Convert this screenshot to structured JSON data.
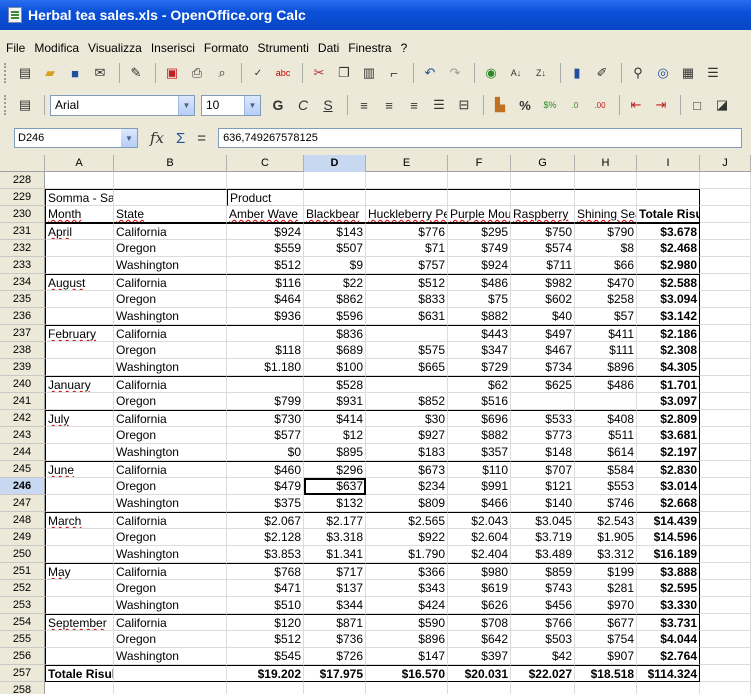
{
  "window": {
    "title": "Herbal tea sales.xls - OpenOffice.org Calc"
  },
  "menu": [
    "File",
    "Modifica",
    "Visualizza",
    "Inserisci",
    "Formato",
    "Strumenti",
    "Dati",
    "Finestra",
    "?"
  ],
  "toolbar": {
    "font_name": "Arial",
    "font_size": "10"
  },
  "formula": {
    "cell_ref": "D246",
    "content": "636,749267578125"
  },
  "columns": [
    "A",
    "B",
    "C",
    "D",
    "E",
    "F",
    "G",
    "H",
    "I",
    "J"
  ],
  "selected_column": "D",
  "selected_row": "246",
  "table": {
    "row_228": "228",
    "header_row_229": {
      "rownum": "229",
      "a": "Somma - Sales $",
      "c": "Product"
    },
    "header_row_230": {
      "rownum": "230",
      "a": "Month",
      "b": "State",
      "c": "Amber Wave",
      "d": "Blackbear",
      "e": "Huckleberry Peach",
      "f": "Purple Mountain",
      "g": "Raspberry",
      "h": "Shining Sea",
      "i": "Totale Risultato"
    },
    "data_rows": [
      {
        "rownum": "231",
        "month": "April",
        "state": "California",
        "c": "$924",
        "d": "$143",
        "e": "$776",
        "f": "$295",
        "g": "$750",
        "h": "$790",
        "i": "$3.678"
      },
      {
        "rownum": "232",
        "month": "",
        "state": "Oregon",
        "c": "$559",
        "d": "$507",
        "e": "$71",
        "f": "$749",
        "g": "$574",
        "h": "$8",
        "i": "$2.468"
      },
      {
        "rownum": "233",
        "month": "",
        "state": "Washington",
        "c": "$512",
        "d": "$9",
        "e": "$757",
        "f": "$924",
        "g": "$711",
        "h": "$66",
        "i": "$2.980"
      },
      {
        "rownum": "234",
        "month": "August",
        "state": "California",
        "c": "$116",
        "d": "$22",
        "e": "$512",
        "f": "$486",
        "g": "$982",
        "h": "$470",
        "i": "$2.588"
      },
      {
        "rownum": "235",
        "month": "",
        "state": "Oregon",
        "c": "$464",
        "d": "$862",
        "e": "$833",
        "f": "$75",
        "g": "$602",
        "h": "$258",
        "i": "$3.094"
      },
      {
        "rownum": "236",
        "month": "",
        "state": "Washington",
        "c": "$936",
        "d": "$596",
        "e": "$631",
        "f": "$882",
        "g": "$40",
        "h": "$57",
        "i": "$3.142"
      },
      {
        "rownum": "237",
        "month": "February",
        "state": "California",
        "c": "",
        "d": "$836",
        "e": "",
        "f": "$443",
        "g": "$497",
        "h": "$411",
        "i": "$2.186"
      },
      {
        "rownum": "238",
        "month": "",
        "state": "Oregon",
        "c": "$118",
        "d": "$689",
        "e": "$575",
        "f": "$347",
        "g": "$467",
        "h": "$111",
        "i": "$2.308"
      },
      {
        "rownum": "239",
        "month": "",
        "state": "Washington",
        "c": "$1.180",
        "d": "$100",
        "e": "$665",
        "f": "$729",
        "g": "$734",
        "h": "$896",
        "i": "$4.305"
      },
      {
        "rownum": "240",
        "month": "January",
        "state": "California",
        "c": "",
        "d": "$528",
        "e": "",
        "f": "$62",
        "g": "$625",
        "h": "$486",
        "i": "$1.701"
      },
      {
        "rownum": "241",
        "month": "",
        "state": "Oregon",
        "c": "$799",
        "d": "$931",
        "e": "$852",
        "f": "$516",
        "g": "",
        "h": "",
        "i": "$3.097"
      },
      {
        "rownum": "242",
        "month": "July",
        "state": "California",
        "c": "$730",
        "d": "$414",
        "e": "$30",
        "f": "$696",
        "g": "$533",
        "h": "$408",
        "i": "$2.809"
      },
      {
        "rownum": "243",
        "month": "",
        "state": "Oregon",
        "c": "$577",
        "d": "$12",
        "e": "$927",
        "f": "$882",
        "g": "$773",
        "h": "$511",
        "i": "$3.681"
      },
      {
        "rownum": "244",
        "month": "",
        "state": "Washington",
        "c": "$0",
        "d": "$895",
        "e": "$183",
        "f": "$357",
        "g": "$148",
        "h": "$614",
        "i": "$2.197"
      },
      {
        "rownum": "245",
        "month": "June",
        "state": "California",
        "c": "$460",
        "d": "$296",
        "e": "$673",
        "f": "$110",
        "g": "$707",
        "h": "$584",
        "i": "$2.830"
      },
      {
        "rownum": "246",
        "month": "",
        "state": "Oregon",
        "c": "$479",
        "d": "$637",
        "e": "$234",
        "f": "$991",
        "g": "$121",
        "h": "$553",
        "i": "$3.014"
      },
      {
        "rownum": "247",
        "month": "",
        "state": "Washington",
        "c": "$375",
        "d": "$132",
        "e": "$809",
        "f": "$466",
        "g": "$140",
        "h": "$746",
        "i": "$2.668"
      },
      {
        "rownum": "248",
        "month": "March",
        "state": "California",
        "c": "$2.067",
        "d": "$2.177",
        "e": "$2.565",
        "f": "$2.043",
        "g": "$3.045",
        "h": "$2.543",
        "i": "$14.439"
      },
      {
        "rownum": "249",
        "month": "",
        "state": "Oregon",
        "c": "$2.128",
        "d": "$3.318",
        "e": "$922",
        "f": "$2.604",
        "g": "$3.719",
        "h": "$1.905",
        "i": "$14.596"
      },
      {
        "rownum": "250",
        "month": "",
        "state": "Washington",
        "c": "$3.853",
        "d": "$1.341",
        "e": "$1.790",
        "f": "$2.404",
        "g": "$3.489",
        "h": "$3.312",
        "i": "$16.189"
      },
      {
        "rownum": "251",
        "month": "May",
        "state": "California",
        "c": "$768",
        "d": "$717",
        "e": "$366",
        "f": "$980",
        "g": "$859",
        "h": "$199",
        "i": "$3.888"
      },
      {
        "rownum": "252",
        "month": "",
        "state": "Oregon",
        "c": "$471",
        "d": "$137",
        "e": "$343",
        "f": "$619",
        "g": "$743",
        "h": "$281",
        "i": "$2.595"
      },
      {
        "rownum": "253",
        "month": "",
        "state": "Washington",
        "c": "$510",
        "d": "$344",
        "e": "$424",
        "f": "$626",
        "g": "$456",
        "h": "$970",
        "i": "$3.330"
      },
      {
        "rownum": "254",
        "month": "September",
        "state": "California",
        "c": "$120",
        "d": "$871",
        "e": "$590",
        "f": "$708",
        "g": "$766",
        "h": "$677",
        "i": "$3.731"
      },
      {
        "rownum": "255",
        "month": "",
        "state": "Oregon",
        "c": "$512",
        "d": "$736",
        "e": "$896",
        "f": "$642",
        "g": "$503",
        "h": "$754",
        "i": "$4.044"
      },
      {
        "rownum": "256",
        "month": "",
        "state": "Washington",
        "c": "$545",
        "d": "$726",
        "e": "$147",
        "f": "$397",
        "g": "$42",
        "h": "$907",
        "i": "$2.764"
      }
    ],
    "total_row": {
      "rownum": "257",
      "label": "Totale Risultato",
      "c": "$19.202",
      "d": "$17.975",
      "e": "$16.570",
      "f": "$20.031",
      "g": "$22.027",
      "h": "$18.518",
      "i": "$114.324"
    },
    "row_258": "258"
  }
}
